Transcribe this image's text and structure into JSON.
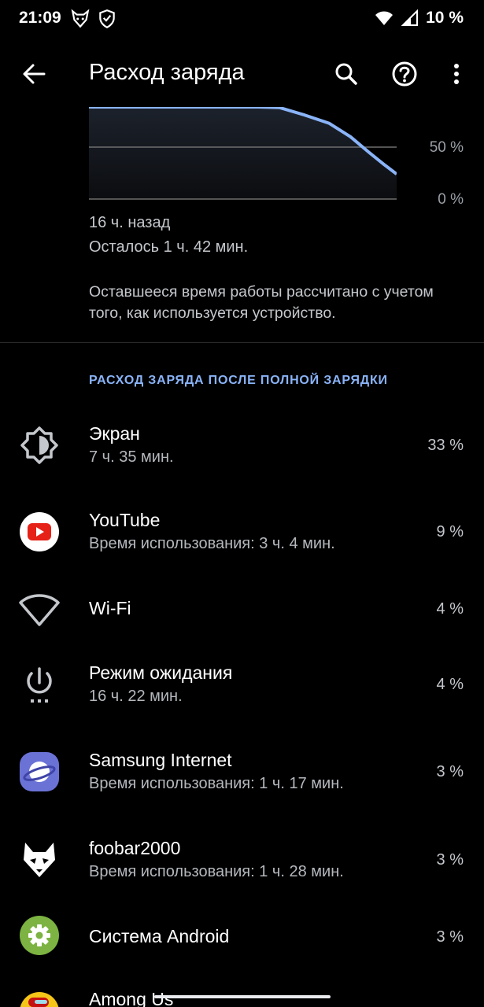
{
  "status_bar": {
    "time": "21:09",
    "battery_text": "10 %",
    "icons": [
      "fox-icon",
      "shield-icon",
      "wifi-icon",
      "signal-icon"
    ]
  },
  "app_bar": {
    "title": "Расход заряда",
    "icons": [
      "back-arrow-icon",
      "search-icon",
      "help-icon",
      "more-vert-icon"
    ]
  },
  "graph": {
    "label_50": "50 %",
    "label_0": "0 %",
    "curve_color": "#8ab4f8",
    "battery_curve": [
      {
        "t": 0.0,
        "level": 100
      },
      {
        "t": 0.17,
        "level": 100
      },
      {
        "t": 0.24,
        "level": 99
      },
      {
        "t": 0.32,
        "level": 98
      },
      {
        "t": 0.4,
        "level": 96
      },
      {
        "t": 0.47,
        "level": 94
      },
      {
        "t": 0.55,
        "level": 91
      },
      {
        "t": 0.62,
        "level": 88
      },
      {
        "t": 0.7,
        "level": 81
      },
      {
        "t": 0.78,
        "level": 73
      },
      {
        "t": 0.85,
        "level": 60
      },
      {
        "t": 0.91,
        "level": 45
      },
      {
        "t": 0.96,
        "level": 33
      },
      {
        "t": 1.0,
        "level": 24
      }
    ]
  },
  "summary": {
    "time_ago": "16 ч. назад",
    "remaining": "Осталось 1 ч. 42 мин.",
    "note": "Оставшееся время работы рассчитано с учетом того, как используется устройство."
  },
  "section": {
    "header": "РАСХОД ЗАРЯДА ПОСЛЕ ПОЛНОЙ ЗАРЯДКИ",
    "accent_color": "#8ab4f8"
  },
  "items": [
    {
      "title": "Экран",
      "subtitle": "7 ч. 35 мин.",
      "percent": "33 %",
      "icon": "brightness-icon"
    },
    {
      "title": "YouTube",
      "subtitle": "Время использования: 3 ч. 4 мин.",
      "percent": "9 %",
      "icon": "youtube-icon"
    },
    {
      "title": "Wi-Fi",
      "subtitle": "",
      "percent": "4 %",
      "icon": "wifi-icon"
    },
    {
      "title": "Режим ожидания",
      "subtitle": "16 ч. 22 мин.",
      "percent": "4 %",
      "icon": "power-icon"
    },
    {
      "title": "Samsung Internet",
      "subtitle": "Время использования: 1 ч. 17 мин.",
      "percent": "3 %",
      "icon": "samsung-internet-icon"
    },
    {
      "title": "foobar2000",
      "subtitle": "Время использования: 1 ч. 28 мин.",
      "percent": "3 %",
      "icon": "foobar2000-icon"
    },
    {
      "title": "Система Android",
      "subtitle": "",
      "percent": "3 %",
      "icon": "android-system-icon"
    },
    {
      "title": "Among Us",
      "subtitle": "",
      "percent": "",
      "icon": "among-us-icon"
    }
  ]
}
